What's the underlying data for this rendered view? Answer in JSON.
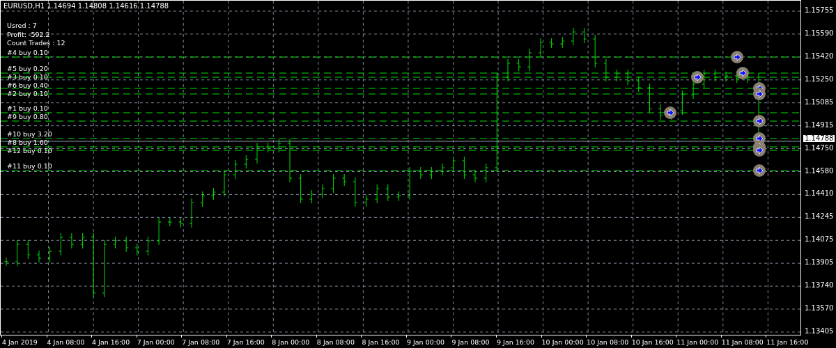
{
  "chart_title": "EURUSD,H1  1.14694 1.14808 1.14616 1.14788",
  "info": [
    "Usred : 7",
    "Profit: -592.2",
    "Count Trades : 12"
  ],
  "orders": [
    "#4 buy 0.10",
    "#5 buy 0.20",
    "#3 buy 0.10",
    "#6 buy 0.40",
    "#2 buy 0.10",
    "#1 buy 0.10",
    "#9 buy 0.80",
    "#10 buy 3.20",
    "#8 buy 1.60",
    "#12 buy 0.10",
    "#11 buy 0.10"
  ],
  "current_price": "1.14788",
  "price_axis": [
    "1.15755",
    "1.15590",
    "1.15420",
    "1.15250",
    "1.15085",
    "1.14915",
    "1.14750",
    "1.14580",
    "1.14410",
    "1.14245",
    "1.14075",
    "1.13905",
    "1.13740",
    "1.13570",
    "1.13405"
  ],
  "time_axis": [
    "4 Jan 2019",
    "4 Jan 08:00",
    "4 Jan 16:00",
    "7 Jan 00:00",
    "7 Jan 08:00",
    "7 Jan 16:00",
    "8 Jan 00:00",
    "8 Jan 08:00",
    "8 Jan 16:00",
    "9 Jan 00:00",
    "9 Jan 08:00",
    "9 Jan 16:00",
    "10 Jan 00:00",
    "10 Jan 08:00",
    "10 Jan 16:00",
    "11 Jan 00:00",
    "11 Jan 08:00",
    "11 Jan 16:00"
  ]
}
